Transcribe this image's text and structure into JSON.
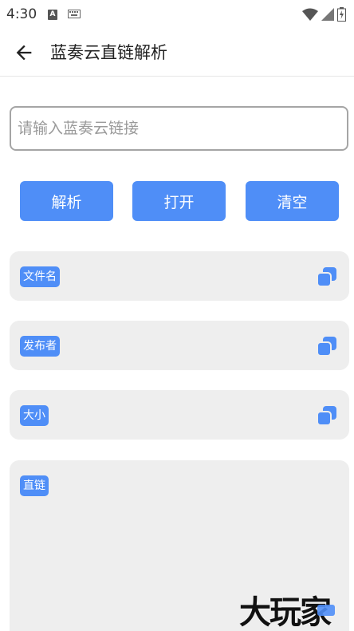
{
  "status_bar": {
    "time": "4:30",
    "notification_icon": "A",
    "icons": [
      "keyboard-icon",
      "wifi-icon",
      "signal-icon",
      "battery-charging-icon"
    ]
  },
  "app_bar": {
    "title": "蓝奏云直链解析",
    "back_icon": "arrow-left-icon"
  },
  "url_input": {
    "value": "",
    "placeholder": "请输入蓝奏云链接"
  },
  "buttons": {
    "parse": "解析",
    "open": "打开",
    "clear": "清空"
  },
  "fields": [
    {
      "label": "文件名",
      "value": ""
    },
    {
      "label": "发布者",
      "value": ""
    },
    {
      "label": "大小",
      "value": ""
    },
    {
      "label": "直链",
      "value": ""
    }
  ],
  "colors": {
    "accent": "#4f8ef7",
    "card_bg": "#eeeeee",
    "input_border": "#a5a5a5"
  },
  "watermark": "大玩家"
}
